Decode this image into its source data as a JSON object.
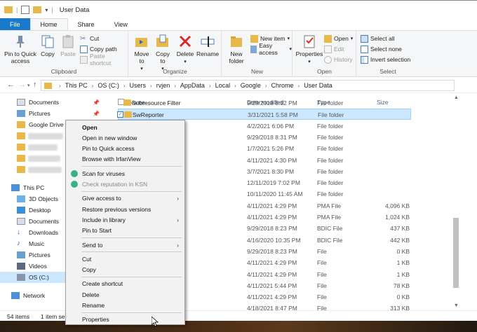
{
  "window": {
    "title": "User Data"
  },
  "tabs": [
    "File",
    "Home",
    "Share",
    "View"
  ],
  "ribbon": {
    "clipboard": {
      "label": "Clipboard",
      "pin": "Pin to Quick access",
      "copy": "Copy",
      "paste": "Paste",
      "cut": "Cut",
      "copy_path": "Copy path",
      "paste_shortcut": "Paste shortcut"
    },
    "organize": {
      "label": "Organize",
      "move_to": "Move to",
      "copy_to": "Copy to",
      "delete": "Delete",
      "rename": "Rename"
    },
    "new": {
      "label": "New",
      "new_folder": "New folder",
      "new_item": "New item",
      "easy_access": "Easy access"
    },
    "open": {
      "label": "Open",
      "properties": "Properties",
      "open": "Open",
      "edit": "Edit",
      "history": "History"
    },
    "select": {
      "label": "Select",
      "select_all": "Select all",
      "select_none": "Select none",
      "invert": "Invert selection"
    }
  },
  "breadcrumb": [
    "This PC",
    "OS (C:)",
    "Users",
    "rvjen",
    "AppData",
    "Local",
    "Google",
    "Chrome",
    "User Data"
  ],
  "nav": {
    "quick": [
      {
        "label": "Documents"
      },
      {
        "label": "Pictures"
      },
      {
        "label": "Google Drive"
      }
    ],
    "this_pc": "This PC",
    "pc_items": [
      "3D Objects",
      "Desktop",
      "Documents",
      "Downloads",
      "Music",
      "Pictures",
      "Videos",
      "OS (C:)"
    ],
    "network": "Network"
  },
  "columns": {
    "name": "Name",
    "date": "Date modified",
    "type": "Type",
    "size": "Size"
  },
  "files": [
    {
      "name": "Subresource Filter",
      "date": "9/29/2018 8:32 PM",
      "type": "File folder",
      "size": ""
    },
    {
      "name": "SwReporter",
      "date": "3/31/2021 5:58 PM",
      "type": "File folder",
      "size": ""
    },
    {
      "name": "",
      "date": "4/2/2021 6:06 PM",
      "type": "File folder",
      "size": ""
    },
    {
      "name": "List64",
      "date": "9/29/2018 8:31 PM",
      "type": "File folder",
      "size": ""
    },
    {
      "name": "nfig",
      "date": "1/7/2021 5:26 PM",
      "type": "File folder",
      "size": ""
    },
    {
      "name": "mmitments",
      "date": "4/11/2021 4:30 PM",
      "type": "File folder",
      "size": ""
    },
    {
      "name": "ads",
      "date": "3/7/2021 8:30 PM",
      "type": "File folder",
      "size": ""
    },
    {
      "name": "",
      "date": "12/11/2019 7:02 PM",
      "type": "File folder",
      "size": ""
    },
    {
      "name": "",
      "date": "10/11/2020 11:45 AM",
      "type": "File folder",
      "size": ""
    },
    {
      "name": "pare.pma",
      "date": "4/11/2021 4:29 PM",
      "type": "PMA File",
      "size": "4,096 KB"
    },
    {
      "name": "active.pma",
      "date": "4/11/2021 4:29 PM",
      "type": "PMA File",
      "size": "1,024 KB"
    },
    {
      "name": "",
      "date": "9/29/2018 8:23 PM",
      "type": "BDIC File",
      "size": "437 KB"
    },
    {
      "name": "",
      "date": "4/16/2020 10:35 PM",
      "type": "BDIC File",
      "size": "442 KB"
    },
    {
      "name": "",
      "date": "9/29/2018 8:23 PM",
      "type": "File",
      "size": "0 KB"
    },
    {
      "name": "",
      "date": "4/11/2021 4:29 PM",
      "type": "File",
      "size": "1 KB"
    },
    {
      "name": "",
      "date": "4/11/2021 4:29 PM",
      "type": "File",
      "size": "1 KB"
    },
    {
      "name": "",
      "date": "4/11/2021 5:44 PM",
      "type": "File",
      "size": "78 KB"
    },
    {
      "name": "",
      "date": "4/11/2021 4:29 PM",
      "type": "File",
      "size": "0 KB"
    },
    {
      "name": "e",
      "date": "4/18/2021 8:47 PM",
      "type": "File",
      "size": "313 KB"
    },
    {
      "name": "nnel IDs",
      "date": "9/29/2018 8:40 PM",
      "type": "File",
      "size": "20 KB"
    }
  ],
  "status": {
    "count": "54 items",
    "selected": "1 item sel"
  },
  "context_menu": [
    {
      "label": "Open",
      "bold": true
    },
    {
      "label": "Open in new window"
    },
    {
      "label": "Pin to Quick access"
    },
    {
      "label": "Browse with IrfanView"
    },
    {
      "sep": true
    },
    {
      "label": "Scan for viruses",
      "icon": "kaspersky-icon"
    },
    {
      "label": "Check reputation in KSN",
      "icon": "kaspersky-icon",
      "disabled": true
    },
    {
      "sep": true
    },
    {
      "label": "Give access to",
      "submenu": true
    },
    {
      "label": "Restore previous versions"
    },
    {
      "label": "Include in library",
      "submenu": true
    },
    {
      "label": "Pin to Start"
    },
    {
      "sep": true
    },
    {
      "label": "Send to",
      "submenu": true
    },
    {
      "sep": true
    },
    {
      "label": "Cut"
    },
    {
      "label": "Copy"
    },
    {
      "sep": true
    },
    {
      "label": "Create shortcut"
    },
    {
      "label": "Delete"
    },
    {
      "label": "Rename"
    },
    {
      "sep": true
    },
    {
      "label": "Properties"
    }
  ],
  "colors": {
    "file_tab": "#1979ca",
    "selection": "#cce8ff",
    "folder": "#e8b84a"
  }
}
